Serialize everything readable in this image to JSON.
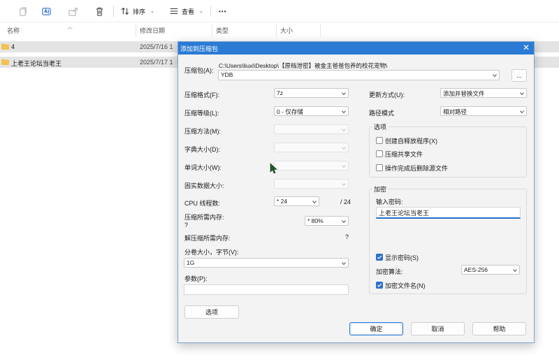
{
  "toolbar": {
    "sort_label": "排序",
    "view_label": "查看",
    "more_label": "•••"
  },
  "file_list": {
    "columns": [
      "名称",
      "修改日期",
      "类型",
      "大小"
    ],
    "rows": [
      {
        "name": "4",
        "date": "2025/7/16 1"
      },
      {
        "name": "上老王论坛当老王",
        "date": "2025/7/17 1"
      }
    ]
  },
  "dialog": {
    "title": "添加到压缩包",
    "archive_label": "压缩包(A):",
    "archive_path": "C:\\Users\\liuxi\\Desktop\\【原档泄密】被金主爸爸包养的校花宠物\\",
    "archive_name": "YDB",
    "browse_label": "...",
    "format_label": "压缩格式(F):",
    "format_value": "7z",
    "level_label": "压缩等级(L):",
    "level_value": "0 - 仅存储",
    "method_label": "压缩方法(M):",
    "dict_label": "字典大小(D):",
    "word_label": "单词大小(W):",
    "solid_label": "固实数据大小:",
    "cpu_label": "CPU 线程数:",
    "cpu_value": "* 24",
    "cpu_total": "/ 24",
    "mem_label": "压缩所需内存:",
    "mem_value": "?",
    "mem_percent": "* 80%",
    "decomp_label": "解压缩所需内存:",
    "decomp_value": "?",
    "volume_label": "分卷大小，字节(V):",
    "volume_value": "1G",
    "params_label": "参数(P):",
    "options_button": "选项",
    "update_label": "更新方式(U):",
    "update_value": "添加并替换文件",
    "path_label": "路径模式",
    "path_value": "相对路径",
    "options_group": "选项",
    "opt_sfx": "创建自释放程序(X)",
    "opt_shared": "压缩共享文件",
    "opt_delete": "操作完成后删除源文件",
    "encrypt_group": "加密",
    "password_label": "输入密码:",
    "password_value": "上老王论坛当老王",
    "show_password": "显示密码(S)",
    "algo_label": "加密算法:",
    "algo_value": "AES-256",
    "encrypt_names": "加密文件名(N)",
    "ok": "确定",
    "cancel": "取消",
    "help": "帮助"
  },
  "colors": {
    "accent": "#2b7bd4",
    "title_bar": "#2b7bd4",
    "selected_row": "#e4e4e4",
    "folder": "#f2c14e"
  }
}
